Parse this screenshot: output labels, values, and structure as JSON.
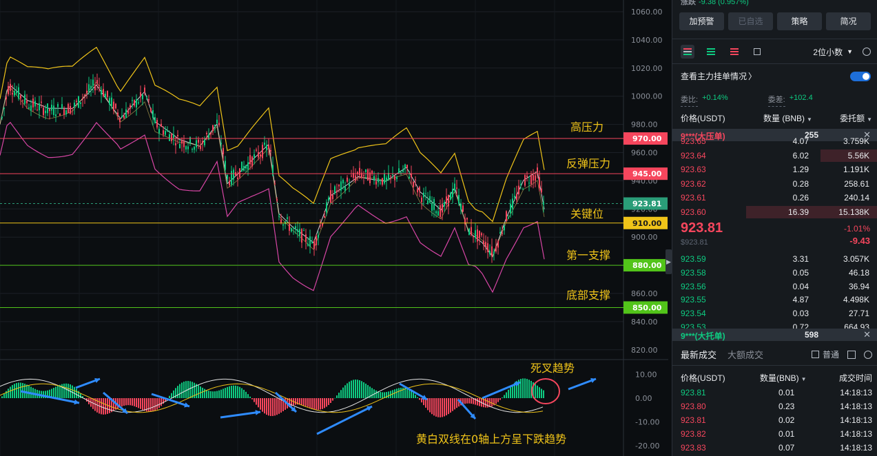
{
  "chart": {
    "price_axis": [
      "1060.00",
      "1040.00",
      "1020.00",
      "1000.00",
      "980.00",
      "960.00",
      "940.00",
      "920.00",
      "900.00",
      "880.00",
      "860.00",
      "840.00",
      "820.00"
    ],
    "macd_axis": [
      "10.00",
      "0.00",
      "-10.00",
      "-20.00"
    ],
    "levels": [
      {
        "label": "970.00",
        "color": "#f6465d",
        "line": "#f6465d",
        "value": 970
      },
      {
        "label": "945.00",
        "color": "#f6465d",
        "line": "#f6465d",
        "value": 945
      },
      {
        "label": "923.81",
        "color": "#2a9d78",
        "line": "#2a9d78",
        "value": 923.81
      },
      {
        "label": "910.00",
        "color": "#f0c419",
        "line": "#f0c419",
        "value": 910
      },
      {
        "label": "880.00",
        "color": "#52c41a",
        "line": "#52c41a",
        "value": 880
      },
      {
        "label": "850.00",
        "color": "#52c41a",
        "line": "#52c41a",
        "value": 850
      }
    ],
    "annotations": {
      "high_resistance": "高压力",
      "rebound_resistance": "反弹压力",
      "key_level": "关键位",
      "first_support": "第一支撑",
      "bottom_support": "底部支撑",
      "death_cross": "死叉趋势",
      "macd_note": "黄白双线在0轴上方呈下跌趋势"
    },
    "colors": {
      "up": "#0ecb81",
      "down": "#f6465d",
      "boll_outer": "#f0c419",
      "boll_lower": "#d846a6",
      "boll_mid": "#cfd3d8"
    }
  },
  "side": {
    "top_partial": "涨跌",
    "top_partial_value": "-9.38 (0.957%)",
    "buttons": [
      "加预警",
      "已自选",
      "策略",
      "简况"
    ],
    "decimal": "2位小数",
    "main_orders": "查看主力挂单情况",
    "ratio_label": "委比:",
    "ratio_value": "+0.14%",
    "diff_label": "委差:",
    "diff_value": "+102.4",
    "ob_header": {
      "price": "价格(USDT)",
      "qty": "数量 (BNB)",
      "total": "委托额"
    },
    "ask_banner": {
      "label": "9***(大压单)",
      "qty": "255"
    },
    "asks": [
      {
        "p": "923.65",
        "q": "4.07",
        "t": "3.759K",
        "bar": 0.0
      },
      {
        "p": "923.64",
        "q": "6.02",
        "t": "5.56K",
        "bar": 0.28
      },
      {
        "p": "923.63",
        "q": "1.29",
        "t": "1.191K",
        "bar": 0.0
      },
      {
        "p": "923.62",
        "q": "0.28",
        "t": "258.61",
        "bar": 0.0
      },
      {
        "p": "923.61",
        "q": "0.26",
        "t": "240.14",
        "bar": 0.0
      },
      {
        "p": "923.60",
        "q": "16.39",
        "t": "15.138K",
        "bar": 0.64
      }
    ],
    "mid": {
      "price": "923.81",
      "sub": "$923.81",
      "pct": "-1.01%",
      "chg": "-9.43"
    },
    "bids": [
      {
        "p": "923.59",
        "q": "3.31",
        "t": "3.057K"
      },
      {
        "p": "923.58",
        "q": "0.05",
        "t": "46.18"
      },
      {
        "p": "923.56",
        "q": "0.04",
        "t": "36.94"
      },
      {
        "p": "923.55",
        "q": "4.87",
        "t": "4.498K"
      },
      {
        "p": "923.54",
        "q": "0.03",
        "t": "27.71"
      },
      {
        "p": "923.53",
        "q": "0.72",
        "t": "664.93"
      }
    ],
    "bid_banner": {
      "label": "9***(大托单)",
      "qty": "598"
    },
    "trade_tabs": {
      "latest": "最新成交",
      "large": "大额成交",
      "normal": "普通"
    },
    "tr_header": {
      "price": "价格(USDT)",
      "qty": "数量(BNB)",
      "time": "成交时间"
    },
    "trades": [
      {
        "p": "923.81",
        "q": "0.01",
        "time": "14:18:13",
        "side": "up"
      },
      {
        "p": "923.80",
        "q": "0.23",
        "time": "14:18:13",
        "side": "down"
      },
      {
        "p": "923.81",
        "q": "0.02",
        "time": "14:18:13",
        "side": "down"
      },
      {
        "p": "923.82",
        "q": "0.01",
        "time": "14:18:13",
        "side": "down"
      },
      {
        "p": "923.83",
        "q": "0.07",
        "time": "14:18:13",
        "side": "down"
      }
    ]
  }
}
